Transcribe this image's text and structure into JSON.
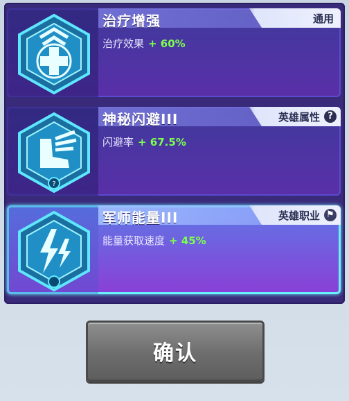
{
  "cards": [
    {
      "title": "治疗增强",
      "tag": "通用",
      "effect_label": "治疗效果",
      "effect_value": "+ 60%",
      "icon": "heal-cross-icon",
      "selected": false
    },
    {
      "title": "神秘闪避III",
      "tag": "英雄属性",
      "effect_label": "闪避率",
      "effect_value": "+ 67.5%",
      "icon": "winged-boot-icon",
      "selected": false
    },
    {
      "title": "军师能量III",
      "tag": "英雄职业",
      "effect_label": "能量获取速度",
      "effect_value": "+ 45%",
      "icon": "lightning-icon",
      "selected": true
    }
  ],
  "confirm_label": "确认",
  "colors": {
    "accent": "#6bf0ff",
    "bonus": "#7cff4f",
    "panel": "#3a2a7a"
  }
}
